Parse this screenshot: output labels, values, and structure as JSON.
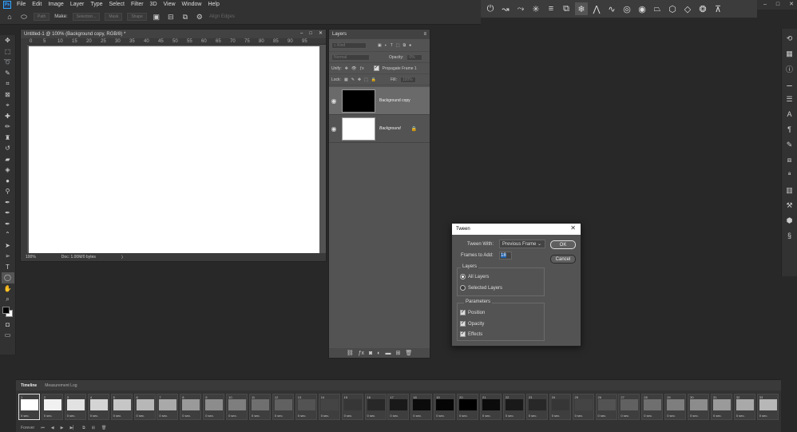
{
  "app": {
    "logo": "Ps"
  },
  "menu": [
    "File",
    "Edit",
    "Image",
    "Layer",
    "Type",
    "Select",
    "Filter",
    "3D",
    "View",
    "Window",
    "Help"
  ],
  "window_controls": {
    "minimize": "–",
    "maximize": "□",
    "close": "✕"
  },
  "options": {
    "make_label": "Make:",
    "path_label": "Path",
    "selection_label": "Selection...",
    "mask_label": "Mask",
    "shape_label": "Shape",
    "align_edges": "Align Edges"
  },
  "document": {
    "tab_title": "Untitled-1 @ 100% (Background copy, RGB/8) *",
    "ruler_marks": [
      "0",
      "5",
      "10",
      "15",
      "20",
      "25",
      "30",
      "35",
      "40",
      "45",
      "50",
      "55",
      "60",
      "65",
      "70",
      "75",
      "80",
      "85",
      "90",
      "95"
    ],
    "zoom": "100%",
    "doc_size": "Doc: 1.00M/0 bytes",
    "status_arrow": "〉"
  },
  "layers": {
    "tab": "Layers",
    "kind_placeholder": "Kind",
    "blend_mode": "Normal",
    "opacity_label": "Opacity:",
    "opacity_value": "0%",
    "unify_label": "Unify:",
    "propagate_label": "Propagate Frame 1",
    "lock_label": "Lock:",
    "fill_label": "Fill:",
    "fill_value": "100%",
    "items": [
      {
        "name": "Background copy",
        "thumb": "#000000",
        "selected": true
      },
      {
        "name": "Background",
        "thumb": "#ffffff",
        "selected": false,
        "locked": true
      }
    ]
  },
  "tween": {
    "title": "Tween",
    "tween_with_label": "Tween With:",
    "tween_with_value": "Previous Frame",
    "frames_label": "Frames to Add:",
    "frames_value": "18",
    "ok_label": "OK",
    "cancel_label": "Cancel",
    "layers_group": "Layers",
    "all_layers": "All Layers",
    "selected_layers": "Selected Layers",
    "params_group": "Parameters",
    "position": "Position",
    "opacity": "Opacity",
    "effects": "Effects"
  },
  "timeline": {
    "tab_timeline": "Timeline",
    "tab_measurement": "Measurement Log",
    "loop": "Forever",
    "frame_delay": "0 sec.",
    "frames": [
      {
        "n": "1",
        "c": "#ffffff"
      },
      {
        "n": "2",
        "c": "#f1f1f1"
      },
      {
        "n": "3",
        "c": "#e2e2e2"
      },
      {
        "n": "4",
        "c": "#d4d4d4"
      },
      {
        "n": "5",
        "c": "#c6c6c6"
      },
      {
        "n": "6",
        "c": "#b7b7b7"
      },
      {
        "n": "7",
        "c": "#a9a9a9"
      },
      {
        "n": "8",
        "c": "#9a9a9a"
      },
      {
        "n": "9",
        "c": "#8c8c8c"
      },
      {
        "n": "10",
        "c": "#7e7e7e"
      },
      {
        "n": "11",
        "c": "#6f6f6f"
      },
      {
        "n": "12",
        "c": "#616161"
      },
      {
        "n": "13",
        "c": "#535353"
      },
      {
        "n": "14",
        "c": "#444444"
      },
      {
        "n": "15",
        "c": "#363636"
      },
      {
        "n": "16",
        "c": "#282828"
      },
      {
        "n": "17",
        "c": "#191919"
      },
      {
        "n": "18",
        "c": "#0b0b0b"
      },
      {
        "n": "19",
        "c": "#050505"
      },
      {
        "n": "20",
        "c": "#000000"
      },
      {
        "n": "21",
        "c": "#0b0b0b"
      },
      {
        "n": "22",
        "c": "#191919"
      },
      {
        "n": "23",
        "c": "#282828"
      },
      {
        "n": "24",
        "c": "#363636"
      },
      {
        "n": "25",
        "c": "#444444"
      },
      {
        "n": "26",
        "c": "#535353"
      },
      {
        "n": "27",
        "c": "#616161"
      },
      {
        "n": "28",
        "c": "#6f6f6f"
      },
      {
        "n": "29",
        "c": "#7e7e7e"
      },
      {
        "n": "30",
        "c": "#8c8c8c"
      },
      {
        "n": "31",
        "c": "#9a9a9a"
      },
      {
        "n": "32",
        "c": "#a9a9a9"
      },
      {
        "n": "33",
        "c": "#b7b7b7"
      },
      {
        "n": "34",
        "c": "#c6c6c6"
      }
    ]
  },
  "colors": {
    "accent": "#31a8ff",
    "panel": "#535353",
    "workspace": "#282828",
    "selected_text": "#1f5fa8"
  }
}
